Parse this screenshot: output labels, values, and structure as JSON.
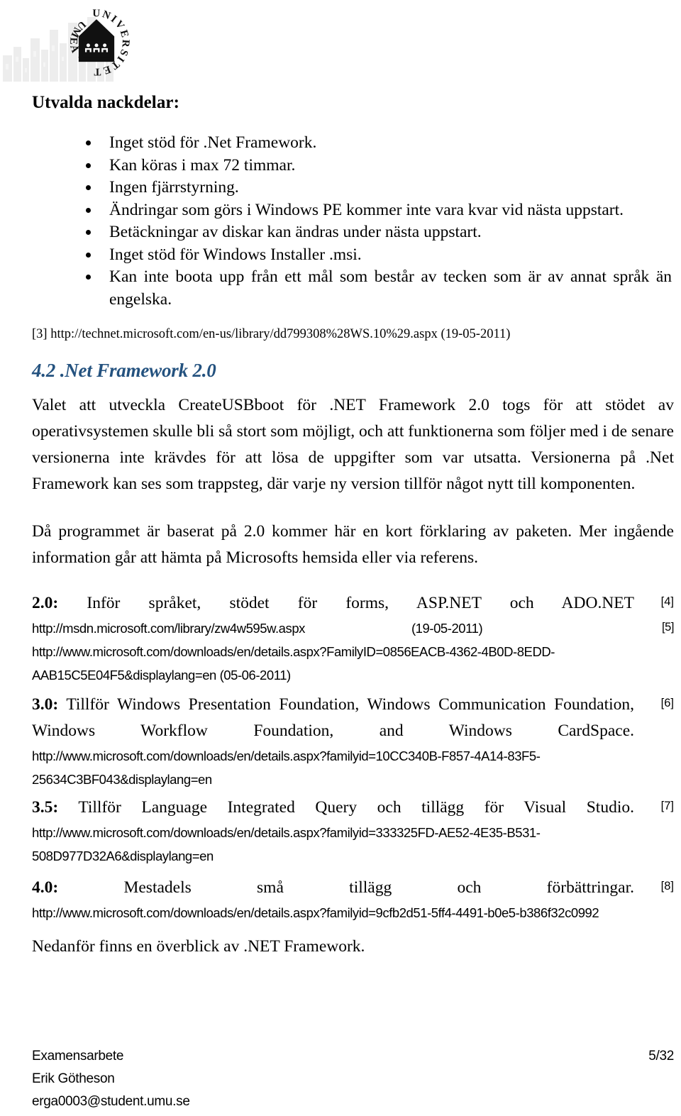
{
  "document": {
    "language": "sv",
    "accent_heading_color": "#24527F",
    "text_color": "#000000",
    "background_color": "#FFFFFF"
  },
  "header": {
    "logo": {
      "icon": "umea-university-seal",
      "ring_text": "UMEÅ UNIVERSITET",
      "watermark_icon": "birch-forest-watermark"
    }
  },
  "disadvantages": {
    "heading": "Utvalda nackdelar:",
    "items": [
      "Inget stöd för .Net Framework.",
      "Kan köras i max 72 timmar.",
      "Ingen fjärrstyrning.",
      "Ändringar som görs i Windows PE kommer inte vara kvar vid nästa uppstart.",
      "Betäckningar av diskar kan ändras under nästa uppstart.",
      "Inget stöd för Windows Installer .msi.",
      "Kan inte boota upp från ett mål som består av tecken som är av annat språk än engelska."
    ]
  },
  "reference_3": "[3] http://technet.microsoft.com/en-us/library/dd799308%28WS.10%29.aspx (19-05-2011)",
  "section": {
    "number": "4.2",
    "title": ".Net Framework 2.0",
    "heading_full": "4.2 .Net Framework 2.0",
    "paragraph_1": "Valet att utveckla CreateUSBboot för .NET Framework 2.0 togs för att stödet av operativsystemen skulle bli så stort som möjligt, och att funktionerna som följer med i de senare versionerna inte krävdes för att lösa de uppgifter som var utsatta. Versionerna på .Net Framework kan ses som trappsteg, där varje ny version tillför något nytt till komponenten.",
    "paragraph_2": "Då programmet är baserat på 2.0 kommer här en kort förklaring av paketen. Mer ingående information går att hämta på Microsofts hemsida eller via referens.",
    "closing_paragraph": "Nedanför finns en överblick av .NET Framework."
  },
  "versions": [
    {
      "label": "2.0:",
      "description": "Inför språket, stödet för forms, ASP.NET och ADO.NET",
      "marker": "[4]",
      "urls": [
        {
          "url": "http://msdn.microsoft.com/library/zw4w595w.aspx",
          "date": "(19-05-2011)",
          "marker": "[5]"
        },
        {
          "url": "http://www.microsoft.com/downloads/en/details.aspx?FamilyID=0856EACB-4362-4B0D-8EDD-",
          "date": "",
          "marker": ""
        },
        {
          "url": "AAB15C5E04F5&displaylang=en (05-06-2011)",
          "date": "",
          "marker": ""
        }
      ]
    },
    {
      "label": "3.0:",
      "description": "Tillför Windows Presentation Foundation, Windows Communication Foundation, Windows Workflow Foundation, and Windows CardSpace.",
      "marker": "[6]",
      "urls": [
        {
          "url": "http://www.microsoft.com/downloads/en/details.aspx?familyid=10CC340B-F857-4A14-83F5-",
          "date": "",
          "marker": ""
        },
        {
          "url": "25634C3BF043&displaylang=en",
          "date": "",
          "marker": ""
        }
      ]
    },
    {
      "label": "3.5:",
      "description": "Tillför Language Integrated Query och tillägg för Visual Studio.",
      "marker": "[7]",
      "urls": [
        {
          "url": "http://www.microsoft.com/downloads/en/details.aspx?familyid=333325FD-AE52-4E35-B531-",
          "date": "",
          "marker": ""
        },
        {
          "url": "508D977D32A6&displaylang=en",
          "date": "",
          "marker": ""
        }
      ]
    },
    {
      "label": "4.0:",
      "description": "Mestadels små tillägg och förbättringar.",
      "marker": "[8]",
      "urls": [
        {
          "url": "http://www.microsoft.com/downloads/en/details.aspx?familyid=9cfb2d51-5ff4-4491-b0e5-b386f32c0992",
          "date": "",
          "marker": ""
        }
      ]
    }
  ],
  "footer": {
    "line_1": "Examensarbete",
    "line_2": "Erik Götheson",
    "line_3": "erga0003@student.umu.se",
    "page_number": "5/32"
  }
}
